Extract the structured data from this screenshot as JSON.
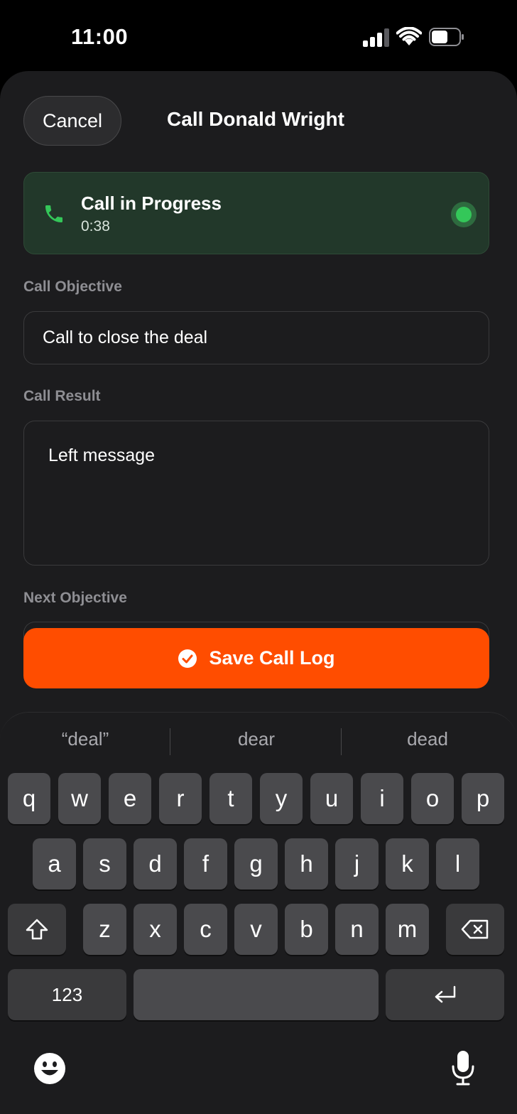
{
  "status_bar": {
    "time": "11:00",
    "signal_icon": "cellular-signal-icon",
    "wifi_icon": "wifi-icon",
    "battery_icon": "battery-icon"
  },
  "header": {
    "cancel_label": "Cancel",
    "title": "Call Donald Wright"
  },
  "call_banner": {
    "status": "Call in Progress",
    "timer": "0:38",
    "icon": "phone-icon",
    "accent": "#34c759"
  },
  "form": {
    "objective_label": "Call Objective",
    "objective_value": "Call to close the deal",
    "result_label": "Call Result",
    "result_value": "Left message",
    "next_label": "Next Objective"
  },
  "save_button": {
    "label": "Save Call Log",
    "icon": "checkmark-circle-icon",
    "color": "#ff4d00"
  },
  "keyboard": {
    "suggestions": [
      "“deal”",
      "dear",
      "dead"
    ],
    "row1": [
      "q",
      "w",
      "e",
      "r",
      "t",
      "y",
      "u",
      "i",
      "o",
      "p"
    ],
    "row2": [
      "a",
      "s",
      "d",
      "f",
      "g",
      "h",
      "j",
      "k",
      "l"
    ],
    "row3": [
      "z",
      "x",
      "c",
      "v",
      "b",
      "n",
      "m"
    ],
    "numbers_label": "123",
    "shift_icon": "shift-icon",
    "delete_icon": "delete-icon",
    "return_icon": "return-icon",
    "emoji_icon": "emoji-icon",
    "mic_icon": "microphone-icon"
  }
}
